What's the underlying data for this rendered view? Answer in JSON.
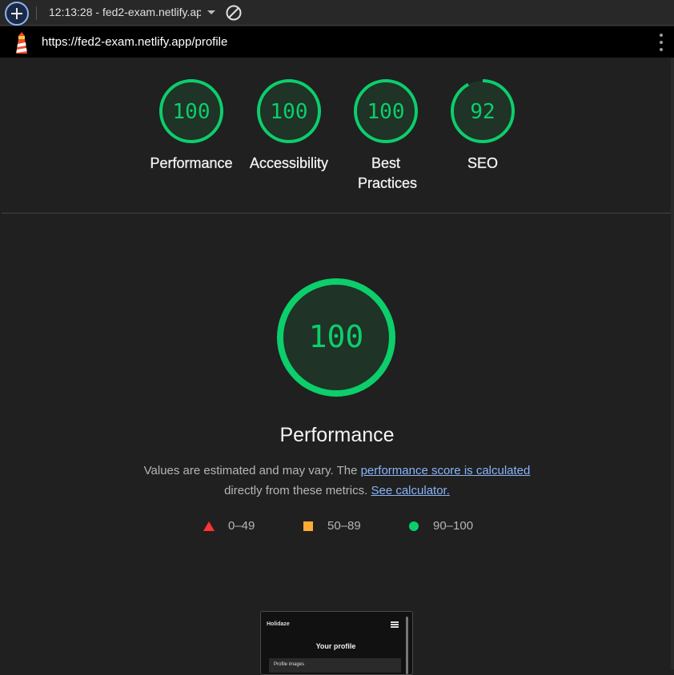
{
  "toolbar": {
    "new_report_icon": "plus-circle-icon",
    "report_select": "12:13:28 - fed2-exam.netlify.app",
    "clear_icon": "block-icon"
  },
  "urlbar": {
    "logo_icon": "lighthouse-icon",
    "url": "https://fed2-exam.netlify.app/profile",
    "menu_icon": "kebab-menu-icon"
  },
  "categories": [
    {
      "score": "100",
      "label": "Performance",
      "fraction": 1.0
    },
    {
      "score": "100",
      "label": "Accessibility",
      "fraction": 1.0
    },
    {
      "score": "100",
      "label": "Best Practices",
      "fraction": 1.0
    },
    {
      "score": "92",
      "label": "SEO",
      "fraction": 0.92
    }
  ],
  "main": {
    "score": "100",
    "fraction": 1.0,
    "title": "Performance",
    "desc_1": "Values are estimated and may vary. The ",
    "desc_link_1": "performance score is calculated",
    "desc_2": "directly from these metrics.",
    "desc_link_2": "See calculator."
  },
  "legend": {
    "fail": "0–49",
    "average": "50–89",
    "pass": "90–100"
  },
  "colors": {
    "pass": "#0cce6b",
    "average": "#ffaa33",
    "fail": "#ff3333",
    "link": "#8ab4f8"
  },
  "screenshot": {
    "brand": "Holidaze",
    "title": "Your profile",
    "card_label": "Profile images"
  }
}
